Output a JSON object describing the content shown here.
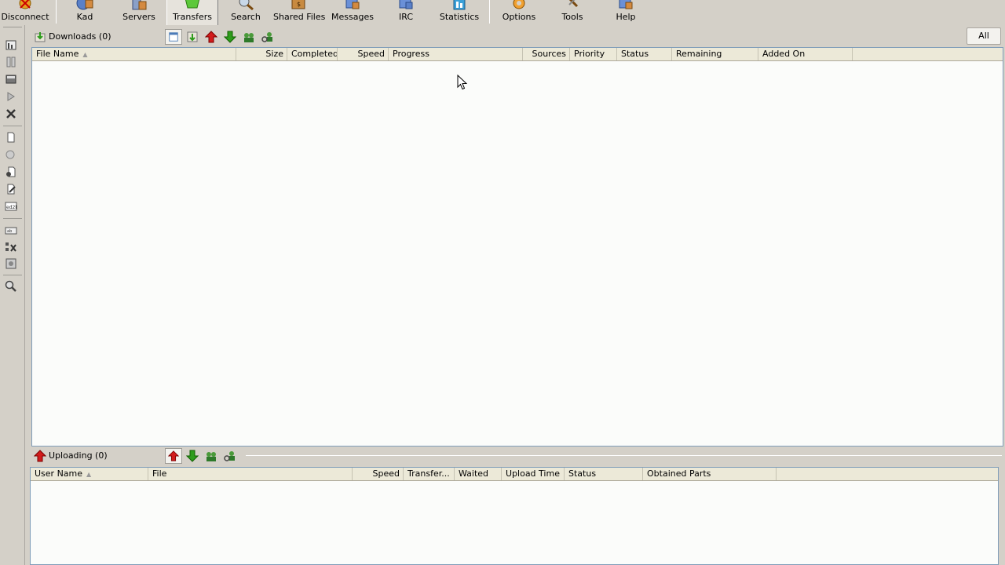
{
  "toolbar": {
    "buttons": [
      {
        "label": "Disconnect",
        "icon": "disconnect-icon"
      },
      {
        "label": "Kad",
        "icon": "kad-icon"
      },
      {
        "label": "Servers",
        "icon": "servers-icon"
      },
      {
        "label": "Transfers",
        "icon": "transfers-icon",
        "active": true
      },
      {
        "label": "Search",
        "icon": "search-icon"
      },
      {
        "label": "Shared Files",
        "icon": "shared-files-icon"
      },
      {
        "label": "Messages",
        "icon": "messages-icon"
      },
      {
        "label": "IRC",
        "icon": "irc-icon"
      },
      {
        "label": "Statistics",
        "icon": "statistics-icon"
      },
      {
        "label": "Options",
        "icon": "options-icon"
      },
      {
        "label": "Tools",
        "icon": "tools-icon"
      },
      {
        "label": "Help",
        "icon": "help-icon"
      }
    ]
  },
  "downloads": {
    "title": "Downloads (0)",
    "filter_button": "All",
    "columns": [
      "File Name",
      "Size",
      "Completed",
      "Speed",
      "Progress",
      "Sources",
      "Priority",
      "Status",
      "Remaining",
      "Added On"
    ],
    "sort_column": "File Name",
    "rows": []
  },
  "uploads": {
    "title": "Uploading (0)",
    "columns": [
      "User Name",
      "File",
      "Speed",
      "Transfer...",
      "Waited",
      "Upload Time",
      "Status",
      "Obtained Parts"
    ],
    "sort_column": "User Name",
    "rows": []
  },
  "colors": {
    "toolbar_bg": "#d4d0c8",
    "list_bg": "#fbfcfa",
    "header_bg": "#ece9d8",
    "arrow_up": "#d21c1c",
    "arrow_down": "#2e9c1c"
  }
}
